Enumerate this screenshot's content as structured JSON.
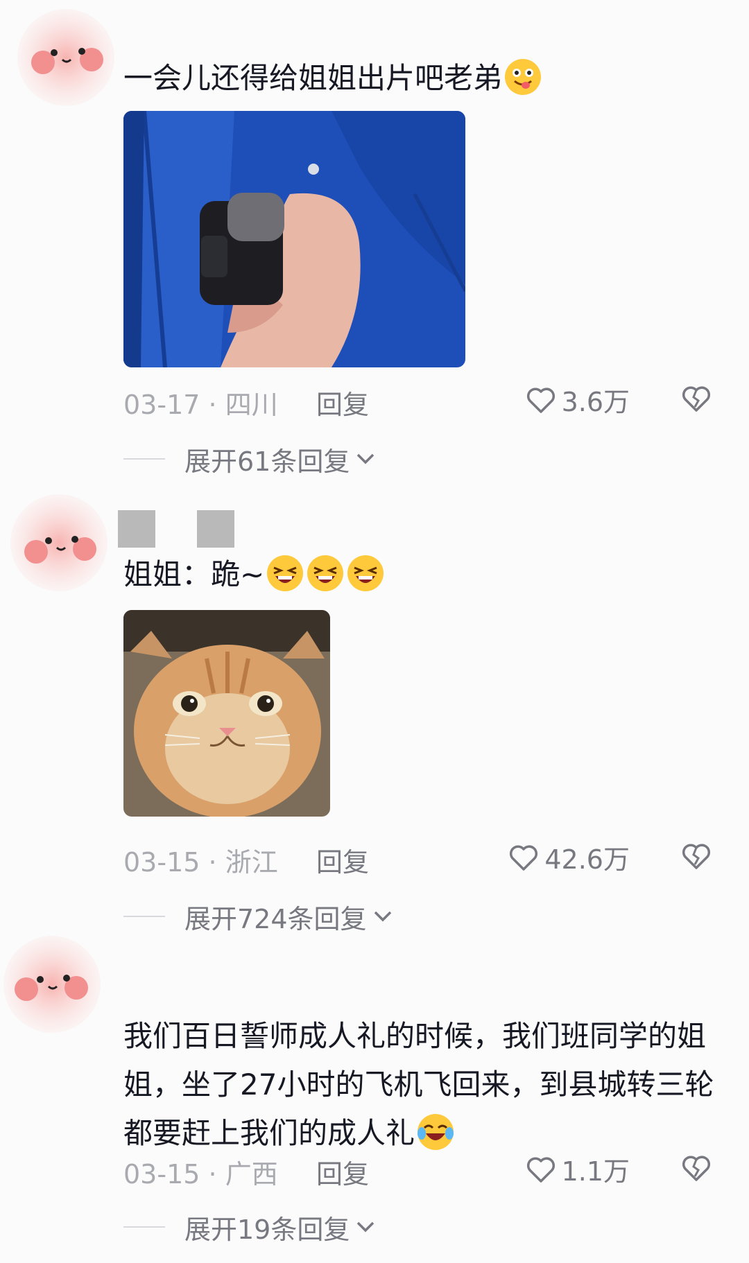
{
  "comments": [
    {
      "text": "一会儿还得给姐姐出片吧老弟",
      "emoji": "tongue-out-face-emoji",
      "image": "hand-holding-camera-photo",
      "date": "03-17",
      "location": "四川",
      "reply_label": "回复",
      "likes": "3.6万",
      "expand_label": "展开61条回复"
    },
    {
      "text": "姐姐：跪~",
      "emoji": "laughing-face-emoji",
      "image": "sad-cat-photo",
      "date": "03-15",
      "location": "浙江",
      "reply_label": "回复",
      "likes": "42.6万",
      "expand_label": "展开724条回复"
    },
    {
      "text": "我们百日誓师成人礼的时候，我们班同学的姐姐，坐了27小时的飞机飞回来，到县城转三轮都要赶上我们的成人礼",
      "emoji": "crying-laughing-emoji",
      "date": "03-15",
      "location": "广西",
      "reply_label": "回复",
      "likes": "1.1万",
      "expand_label": "展开19条回复"
    }
  ],
  "separator": "·",
  "colors": {
    "muted": "#a9aab0",
    "secondary": "#777880",
    "text": "#161823",
    "avatar_blush": "#f28f8f"
  }
}
